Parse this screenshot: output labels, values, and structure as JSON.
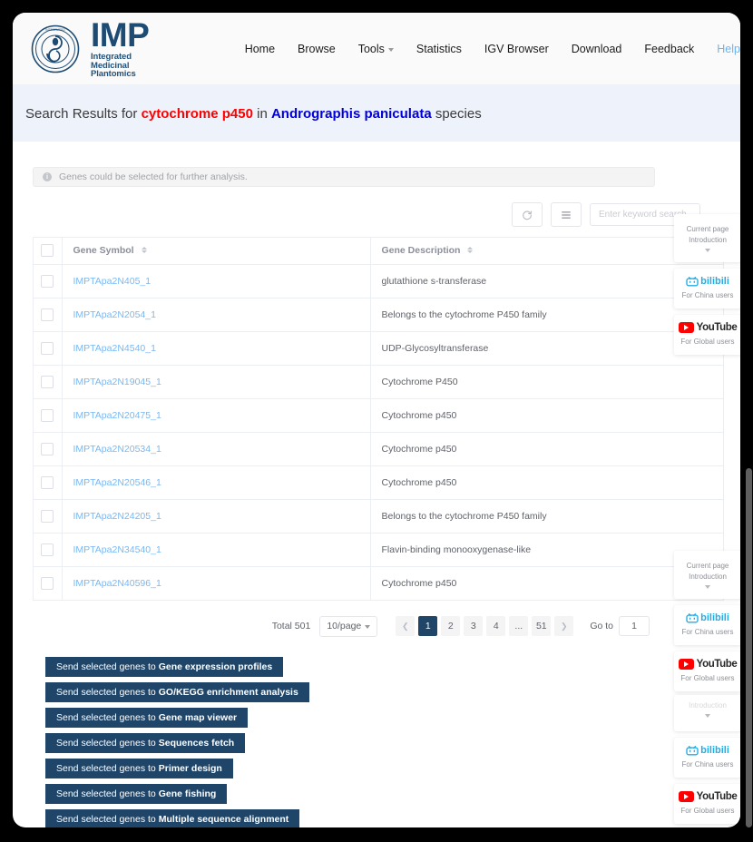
{
  "header": {
    "logo_icon": "imp-seal-logo-icon",
    "brand_title": "IMP",
    "brand_subtitle": "Integrated Medicinal Plantomics",
    "nav": [
      {
        "label": "Home",
        "has_caret": false,
        "active": false
      },
      {
        "label": "Browse",
        "has_caret": false,
        "active": false
      },
      {
        "label": "Tools",
        "has_caret": true,
        "active": false
      },
      {
        "label": "Statistics",
        "has_caret": false,
        "active": false
      },
      {
        "label": "IGV Browser",
        "has_caret": false,
        "active": false
      },
      {
        "label": "Download",
        "has_caret": false,
        "active": false
      },
      {
        "label": "Feedback",
        "has_caret": false,
        "active": false
      },
      {
        "label": "Help",
        "has_caret": false,
        "active": true
      }
    ]
  },
  "banner": {
    "prefix": "Search Results for ",
    "keyword": "cytochrome p450",
    "middle": " in ",
    "species": "Andrographis paniculata",
    "suffix": " species",
    "keyword_color": "#ff0000",
    "species_color": "#0000dd",
    "background": "#eef2fb"
  },
  "alert": {
    "icon": "info-circle-icon",
    "text": "Genes could be selected for further analysis."
  },
  "toolbar": {
    "refresh_icon": "refresh-icon",
    "columns_icon": "column-settings-icon",
    "search_placeholder": "Enter keyword search",
    "search_value": ""
  },
  "table": {
    "columns": [
      {
        "key": "check",
        "label": ""
      },
      {
        "key": "symbol",
        "label": "Gene Symbol",
        "sortable": true
      },
      {
        "key": "desc",
        "label": "Gene Description",
        "sortable": true
      }
    ],
    "rows": [
      {
        "symbol": "IMPTApa2N405_1",
        "desc": "glutathione s-transferase"
      },
      {
        "symbol": "IMPTApa2N2054_1",
        "desc": "Belongs to the cytochrome P450 family"
      },
      {
        "symbol": "IMPTApa2N4540_1",
        "desc": "UDP-Glycosyltransferase"
      },
      {
        "symbol": "IMPTApa2N19045_1",
        "desc": "Cytochrome P450"
      },
      {
        "symbol": "IMPTApa2N20475_1",
        "desc": "Cytochrome p450"
      },
      {
        "symbol": "IMPTApa2N20534_1",
        "desc": "Cytochrome p450"
      },
      {
        "symbol": "IMPTApa2N20546_1",
        "desc": "Cytochrome p450"
      },
      {
        "symbol": "IMPTApa2N24205_1",
        "desc": "Belongs to the cytochrome P450 family"
      },
      {
        "symbol": "IMPTApa2N34540_1",
        "desc": "Flavin-binding monooxygenase-like"
      },
      {
        "symbol": "IMPTApa2N40596_1",
        "desc": "Cytochrome p450"
      }
    ]
  },
  "pagination": {
    "total_label": "Total 501",
    "page_size": "10/page",
    "prev_icon": "chevron-left-icon",
    "next_icon": "chevron-right-icon",
    "pages": [
      "1",
      "2",
      "3",
      "4",
      "...",
      "51"
    ],
    "current_page": "1",
    "goto_label": "Go to",
    "goto_value": "1"
  },
  "actions": [
    {
      "prefix": "Send selected genes to ",
      "target": "Gene expression profiles"
    },
    {
      "prefix": "Send selected genes to ",
      "target": "GO/KEGG enrichment analysis"
    },
    {
      "prefix": "Send selected genes to ",
      "target": "Gene map viewer"
    },
    {
      "prefix": "Send selected genes to ",
      "target": "Sequences fetch"
    },
    {
      "prefix": "Send selected genes to ",
      "target": "Primer design"
    },
    {
      "prefix": "Send selected genes to ",
      "target": "Gene fishing"
    },
    {
      "prefix": "Send selected genes to ",
      "target": "Multiple sequence alignment"
    }
  ],
  "side_panels": {
    "intro_line1": "Current page",
    "intro_line2": "Introduction",
    "bilibili_word": "bilibili",
    "bilibili_caption": "For China users",
    "youtube_word": "YouTube",
    "youtube_caption": "For Global users"
  },
  "colors": {
    "brand_navy": "#1f4568",
    "link_blue": "#79b8f3",
    "accent_help": "#6cb4ee",
    "banner_bg": "#eef2fb",
    "youtube_red": "#ff0000",
    "bilibili_blue": "#23ade5"
  }
}
